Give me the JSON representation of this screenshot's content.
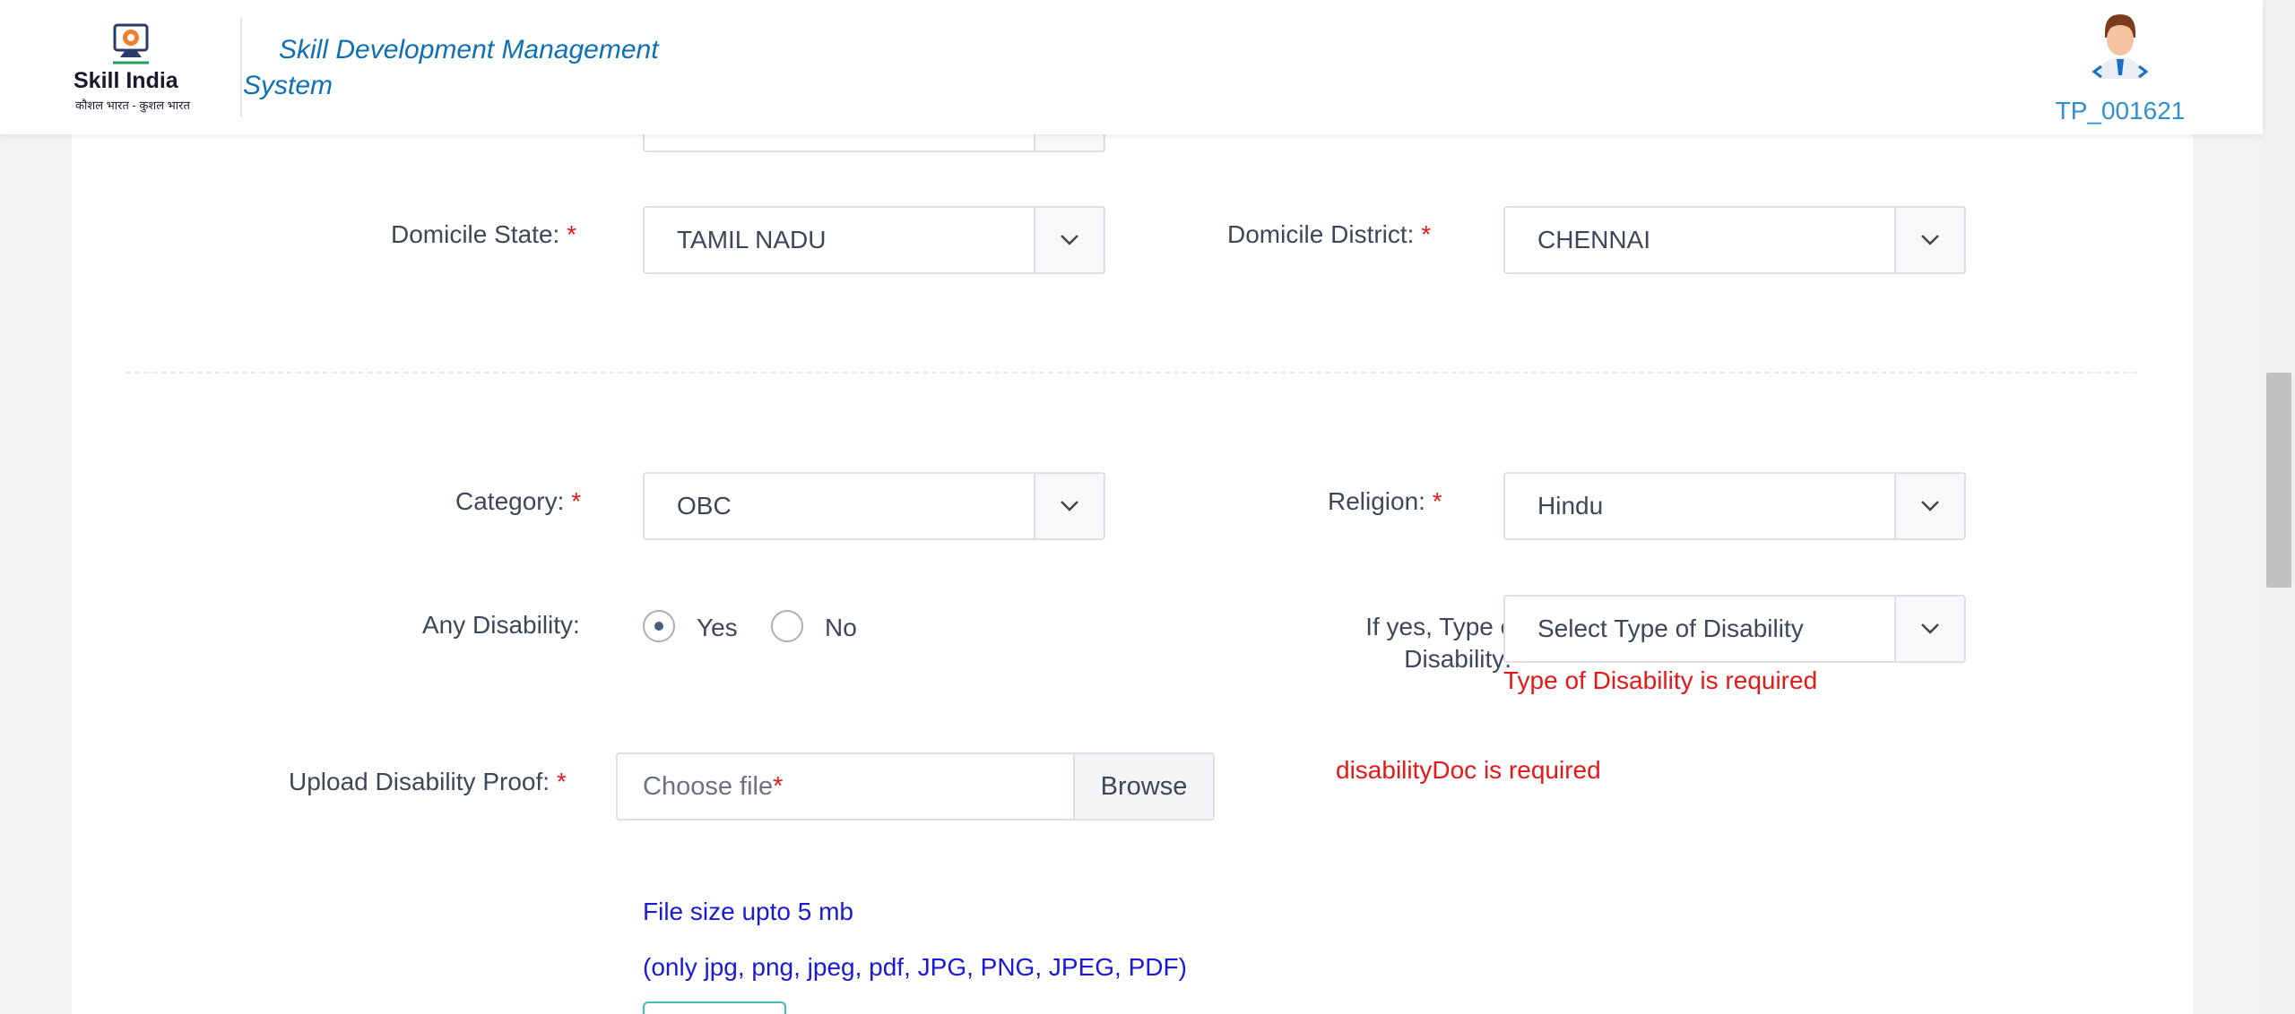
{
  "header": {
    "logo_text": "Skill India",
    "logo_subtext": "कौशल भारत - कुशल भारत",
    "app_title": "Skill Development Management System",
    "user_id": "TP_001621"
  },
  "form": {
    "domicile_state": {
      "label": "Domicile State:",
      "required": "*",
      "value": "TAMIL NADU"
    },
    "domicile_district": {
      "label": "Domicile District:",
      "required": "*",
      "value": "CHENNAI"
    },
    "category": {
      "label": "Category:",
      "required": "*",
      "value": "OBC"
    },
    "religion": {
      "label": "Religion:",
      "required": "*",
      "value": "Hindu"
    },
    "any_disability": {
      "label": "Any Disability:",
      "options": [
        {
          "label": "Yes",
          "checked": true
        },
        {
          "label": "No",
          "checked": false
        }
      ]
    },
    "disability_type": {
      "label_line1": "If yes, Type of",
      "label_line2": "Disability:",
      "required": "*",
      "placeholder": "Select Type of Disability",
      "error": "Type of Disability is required"
    },
    "disability_proof": {
      "label": "Upload Disability Proof:",
      "required": "*",
      "placeholder": "Choose file",
      "placeholder_required": "*",
      "browse_label": "Browse",
      "error": "disabilityDoc is required",
      "note_size": "File size upto 5 mb",
      "note_types": "(only jpg, png, jpeg, pdf, JPG, PNG, JPEG, PDF)"
    }
  },
  "colors": {
    "accent_blue": "#0f6fb5",
    "error_red": "#e31919",
    "note_blue": "#1a1ad6"
  },
  "icons": {
    "select_toggle": "chevron-down-icon",
    "user": "user-avatar-icon",
    "logo": "skill-india-logo"
  }
}
